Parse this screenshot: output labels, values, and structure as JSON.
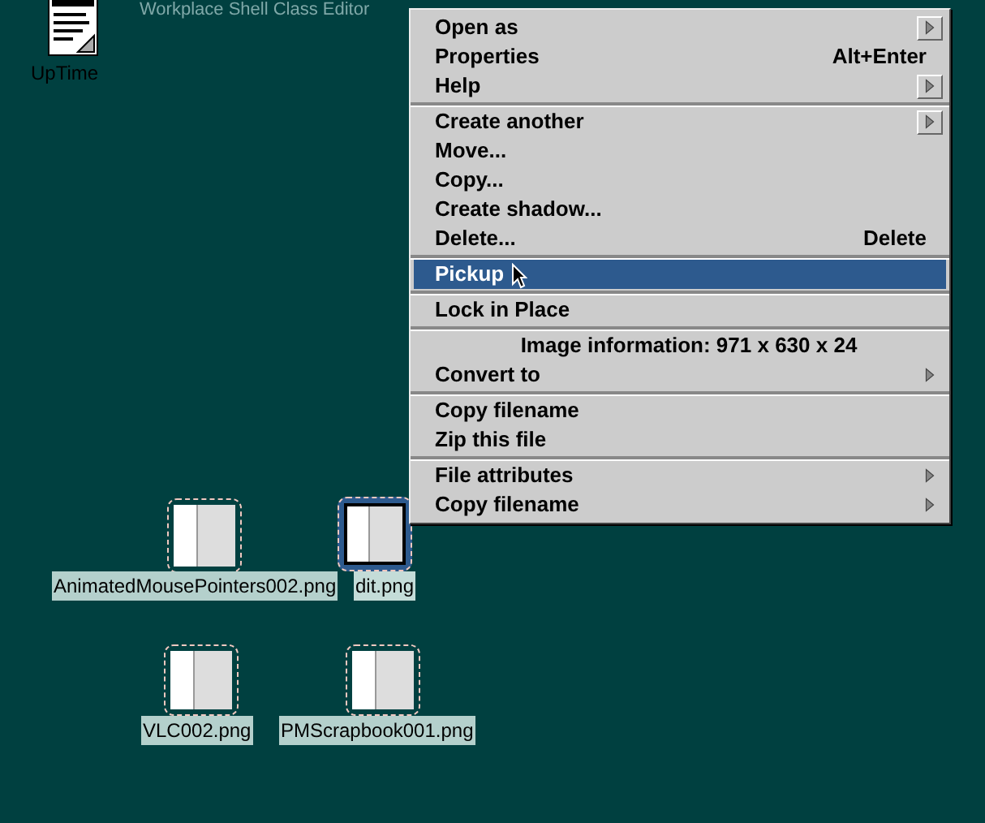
{
  "desktop": {
    "title_text": "Workplace Shell Class Editor",
    "icons": [
      {
        "label": "UpTime",
        "kind": "program"
      },
      {
        "label": "AnimatedMousePointers002.png",
        "kind": "image",
        "selected": false
      },
      {
        "label": "dit.png",
        "kind": "image",
        "selected": true
      },
      {
        "label": "VLC002.png",
        "kind": "image",
        "selected": false
      },
      {
        "label": "PMScrapbook001.png",
        "kind": "image",
        "selected": false
      }
    ]
  },
  "context_menu": {
    "groups": [
      [
        {
          "label": "Open as",
          "kind": "submenu-button",
          "selected": false
        },
        {
          "label": "Properties",
          "kind": "item",
          "shortcut": "Alt+Enter",
          "selected": false
        },
        {
          "label": "Help",
          "kind": "submenu-button",
          "selected": false
        }
      ],
      [
        {
          "label": "Create another",
          "kind": "submenu-button",
          "selected": false
        },
        {
          "label": "Move...",
          "kind": "item",
          "selected": false
        },
        {
          "label": "Copy...",
          "kind": "item",
          "selected": false
        },
        {
          "label": "Create shadow...",
          "kind": "item",
          "selected": false
        },
        {
          "label": "Delete...",
          "kind": "item",
          "shortcut": "Delete",
          "selected": false
        }
      ],
      [
        {
          "label": "Pickup",
          "kind": "item",
          "selected": true
        }
      ],
      [
        {
          "label": "Lock in Place",
          "kind": "item",
          "selected": false
        }
      ],
      [
        {
          "label": "Image information: 971 x 630 x 24",
          "kind": "info",
          "selected": false
        },
        {
          "label": "Convert to",
          "kind": "submenu",
          "selected": false
        }
      ],
      [
        {
          "label": "Copy filename",
          "kind": "item",
          "selected": false
        },
        {
          "label": "Zip this file",
          "kind": "item",
          "selected": false
        }
      ],
      [
        {
          "label": "File attributes",
          "kind": "submenu",
          "selected": false
        },
        {
          "label": "Copy filename",
          "kind": "submenu",
          "selected": false
        }
      ]
    ]
  }
}
